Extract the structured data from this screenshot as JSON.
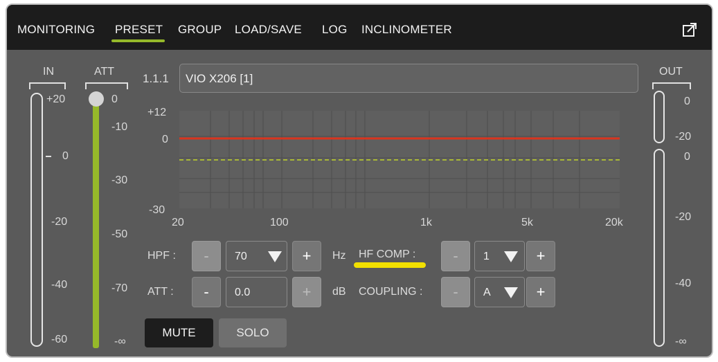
{
  "tabs": [
    {
      "label": "MONITORING"
    },
    {
      "label": "PRESET"
    },
    {
      "label": "GROUP"
    },
    {
      "label": "LOAD/SAVE"
    },
    {
      "label": "LOG"
    },
    {
      "label": "INCLINOMETER"
    }
  ],
  "active_tab": "PRESET",
  "in_meter": {
    "label": "IN",
    "ticks": [
      "+20",
      "0",
      "-20",
      "-40",
      "-60"
    ]
  },
  "att_meter": {
    "label": "ATT",
    "ticks": [
      "0",
      "-10",
      "-30",
      "-50",
      "-70",
      "-∞"
    ],
    "level": 0
  },
  "out_meter": {
    "label": "OUT",
    "ticks_top": [
      "0",
      "-20"
    ],
    "ticks_bottom": [
      "0",
      "-20",
      "-40",
      "-∞"
    ]
  },
  "channel": {
    "id": "1.1.1",
    "name": "VIO X206 [1]"
  },
  "eq_graph": {
    "y_ticks": [
      "+12",
      "0",
      "-30"
    ],
    "x_ticks": [
      "20",
      "100",
      "1k",
      "5k",
      "20k"
    ],
    "colors": {
      "response": "#d9341e",
      "reference": "#a9b836"
    }
  },
  "hpf": {
    "label": "HPF :",
    "minus": "-",
    "value": "70",
    "plus": "+",
    "unit": "Hz"
  },
  "att": {
    "label": "ATT :",
    "minus": "-",
    "value": "0.0",
    "plus": "+",
    "unit": "dB"
  },
  "hf_comp": {
    "label": "HF COMP :",
    "minus": "-",
    "value": "1",
    "plus": "+"
  },
  "coupling": {
    "label": "COUPLING :",
    "minus": "-",
    "value": "A",
    "plus": "+"
  },
  "buttons": {
    "mute": "MUTE",
    "solo": "SOLO"
  },
  "icons": {
    "expand": "expand-icon"
  },
  "colors": {
    "accent": "#96b92a",
    "highlight": "#f2e000"
  }
}
